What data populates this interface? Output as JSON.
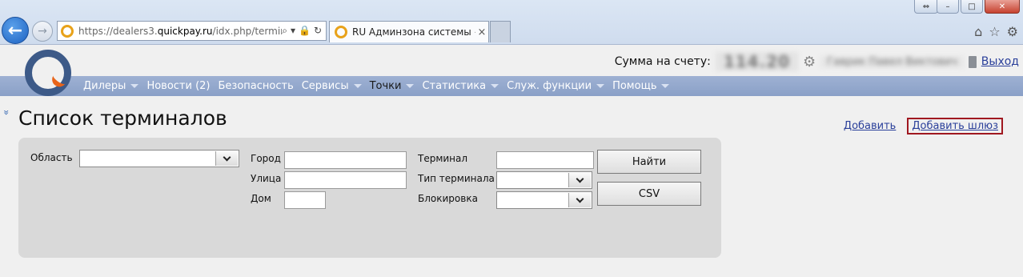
{
  "browser": {
    "url_prefix": "https://dealers3.",
    "url_domain": "quickpay.ru",
    "url_path": "/idx.php/terminal",
    "tab_title": "RU Админзона системы «...",
    "tab_close": "×",
    "min_glyph": "–",
    "max_glyph": "□",
    "close_glyph": "✕",
    "ext_glyph": "⇔",
    "back_glyph": "←",
    "forward_glyph": "→",
    "search_glyph": "⌕",
    "dropdown_glyph": "▾",
    "lock_glyph": "🔒",
    "refresh_glyph": "↻",
    "home_glyph": "⌂",
    "fav_glyph": "☆",
    "settings_glyph": "⚙"
  },
  "header": {
    "balance_label": "Сумма на счету:",
    "balance_value": "114.20",
    "settings_glyph": "⚙",
    "username": "Гаврик Павел Виктович",
    "logout": "Выход"
  },
  "menu": [
    {
      "label": "Дилеры",
      "dropdown": true
    },
    {
      "label": "Новости (2)",
      "dropdown": false
    },
    {
      "label": "Безопасность",
      "dropdown": false
    },
    {
      "label": "Сервисы",
      "dropdown": true
    },
    {
      "label": "Точки",
      "dropdown": true,
      "active": true
    },
    {
      "label": "Статистика",
      "dropdown": true
    },
    {
      "label": "Служ. функции",
      "dropdown": true
    },
    {
      "label": "Помощь",
      "dropdown": true
    }
  ],
  "page": {
    "collapse_glyph": "»",
    "title": "Список терминалов",
    "add_link": "Добавить",
    "add_gateway_link": "Добавить шлюз"
  },
  "filters": {
    "region_label": "Область",
    "region_value": "",
    "city_label": "Город",
    "city_value": "",
    "street_label": "Улица",
    "street_value": "",
    "house_label": "Дом",
    "house_value": "",
    "terminal_label": "Терминал",
    "terminal_value": "",
    "terminal_type_label": "Тип терминала",
    "terminal_type_value": "",
    "blocking_label": "Блокировка",
    "blocking_value": "",
    "find_button": "Найти",
    "csv_button": "CSV"
  }
}
